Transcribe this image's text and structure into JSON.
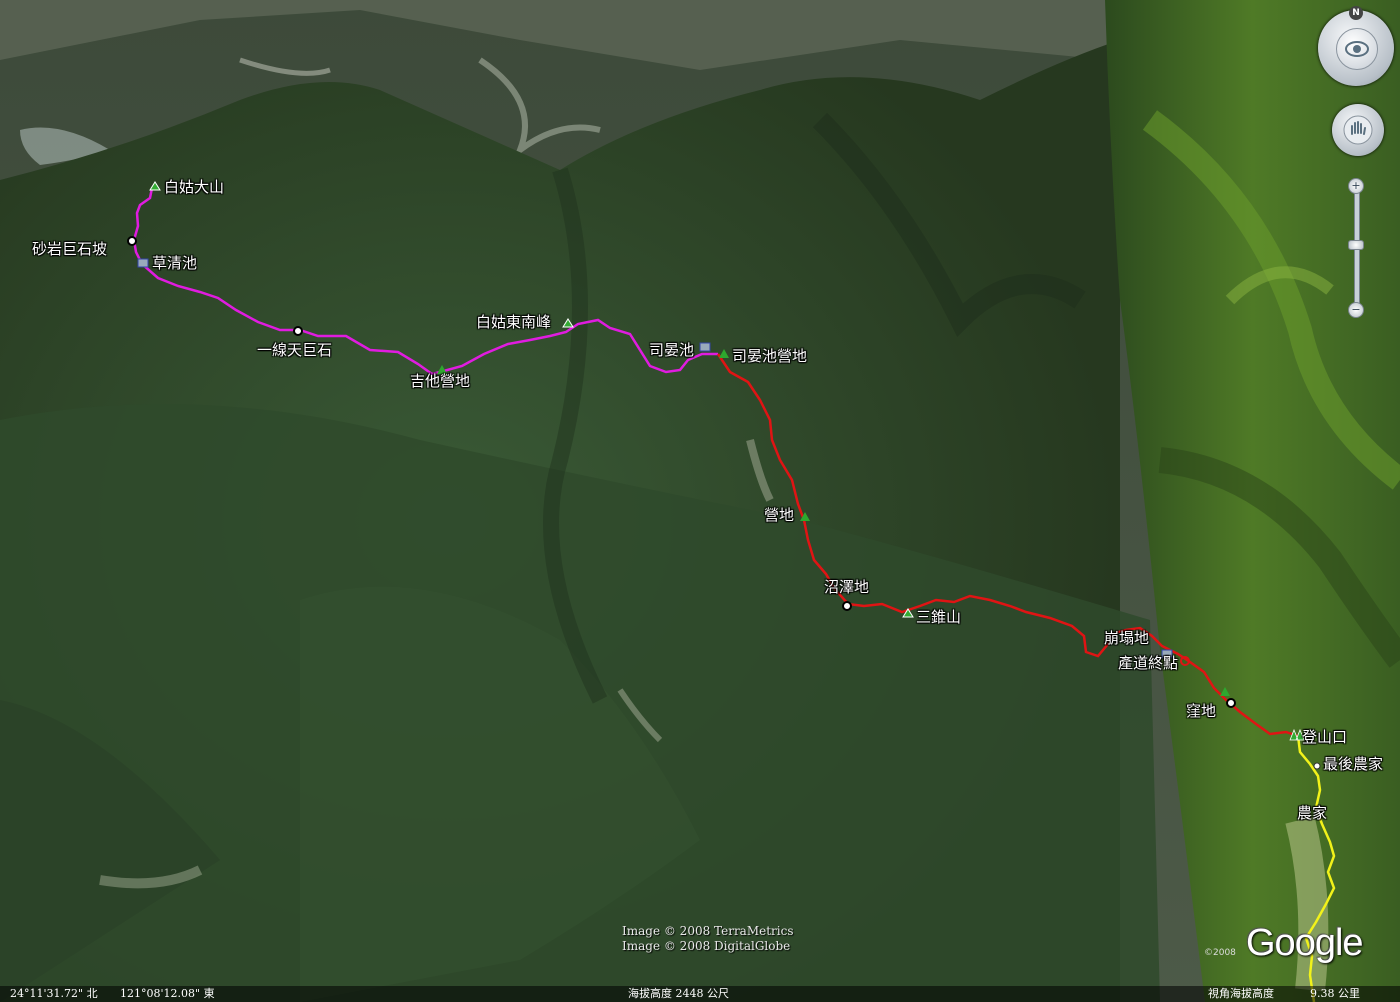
{
  "map": {
    "type": "3D satellite terrain view with GPS track",
    "imagery_colors": {
      "forest": "#2f4a2c",
      "forest_dark": "#223a22",
      "track_magenta": "#e01ce0",
      "track_red": "#e01414",
      "track_yellow": "#f2f21a"
    }
  },
  "labels": {
    "baigu_main": "白姑大山",
    "sandstone_slope": "砂岩巨石坡",
    "caoqing_pond": "草清池",
    "yixiantian_rock": "一線天巨石",
    "jita_camp": "吉他營地",
    "baigu_se_peak": "白姑東南峰",
    "siyan_pond": "司晏池",
    "siyan_camp": "司晏池營地",
    "camp": "營地",
    "marsh": "沼澤地",
    "sanzhui_mtn": "三錐山",
    "collapse": "崩塌地",
    "road_end": "產道終點",
    "hollow": "窪地",
    "trailhead": "登山口",
    "last_farm": "最後農家",
    "farm": "農家"
  },
  "credits": {
    "line1": "Image © 2008 TerraMetrics",
    "line2": "Image © 2008 DigitalGlobe",
    "logo": "Google",
    "year": "©2008"
  },
  "status": {
    "lat": "24°11'31.72\" 北",
    "lon": "121°08'12.08\" 東",
    "elevation": "海拔高度 2448 公尺",
    "eye_alt_label": "視角海拔高度",
    "eye_alt_value": "9.38 公里"
  },
  "controls": {
    "north": "N",
    "zoom_in": "+",
    "zoom_out": "−"
  }
}
